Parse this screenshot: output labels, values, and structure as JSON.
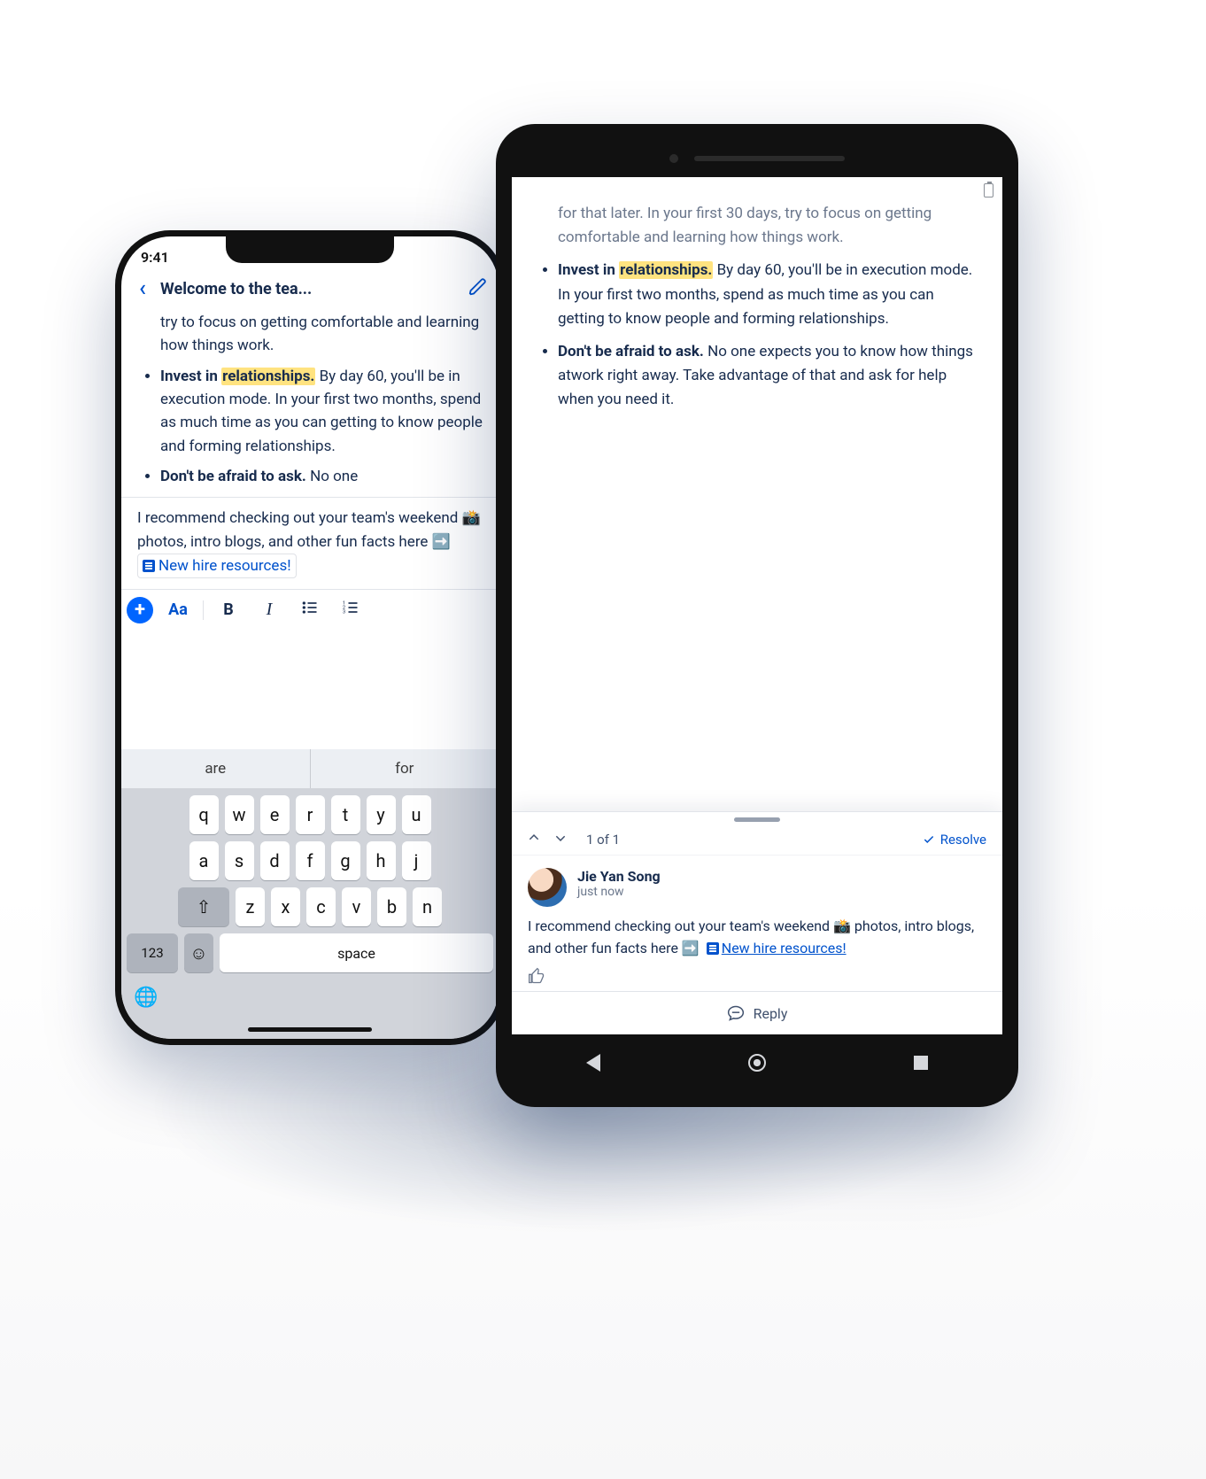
{
  "iphone": {
    "time": "9:41",
    "title": "Welcome to the tea...",
    "doc": {
      "lead_fragment": "try to focus on getting comfortable and learning how things work.",
      "bullets": [
        {
          "bold": "Invest in ",
          "highlight": "relationships.",
          "rest": " By day 60, you'll be in execution mode. In your first two months, spend as much time as you can getting to know people and forming relationships."
        },
        {
          "bold": "Don't be afraid to ask.",
          "rest": " No one"
        }
      ]
    },
    "comment_preview": {
      "line1": "I recommend checking out your team's",
      "line2_prefix": "weekend ",
      "camera_emoji": "📸",
      "line2_suffix": " photos, intro blogs, and other fun",
      "line3_prefix": "facts here ",
      "arrow_emoji": "➡️",
      "chip_label": "New hire resources!"
    },
    "toolbar": {
      "text_style": "Aa",
      "bold": "B",
      "italic": "I"
    },
    "keyboard": {
      "suggestions": [
        "are",
        "for"
      ],
      "row1": [
        "q",
        "w",
        "e",
        "r",
        "t",
        "y",
        "u"
      ],
      "row2": [
        "a",
        "s",
        "d",
        "f",
        "g",
        "h",
        "j"
      ],
      "row3_shift": "⇧",
      "row3": [
        "z",
        "x",
        "c",
        "v",
        "b",
        "n"
      ],
      "num_key": "123",
      "emoji_key": "☺",
      "space_key": "space",
      "globe": "🌐"
    }
  },
  "android": {
    "doc": {
      "top_fragment": "for that later. In your first 30 days, try to focus on getting comfortable and learning how things work.",
      "bullets": [
        {
          "bold": "Invest in ",
          "highlight": "relationships.",
          "rest": " By day 60, you'll be in execution mode. In your first two months, spend as much time as you can getting to know people and forming relationships."
        },
        {
          "bold": "Don't be afraid to ask.",
          "rest": " No one expects you to know how things atwork right away. Take advantage of that and ask for help when you need it."
        }
      ]
    },
    "sheet": {
      "counter": "1 of 1",
      "resolve": "Resolve",
      "comment": {
        "author": "Jie Yan Song",
        "time": "just now",
        "body_prefix": "I recommend checking out your team's weekend ",
        "camera_emoji": "📸",
        "body_mid": " photos, intro blogs, and other fun facts here ",
        "arrow_emoji": "➡️",
        "link_label": "New hire resources!"
      },
      "reply": "Reply"
    }
  }
}
